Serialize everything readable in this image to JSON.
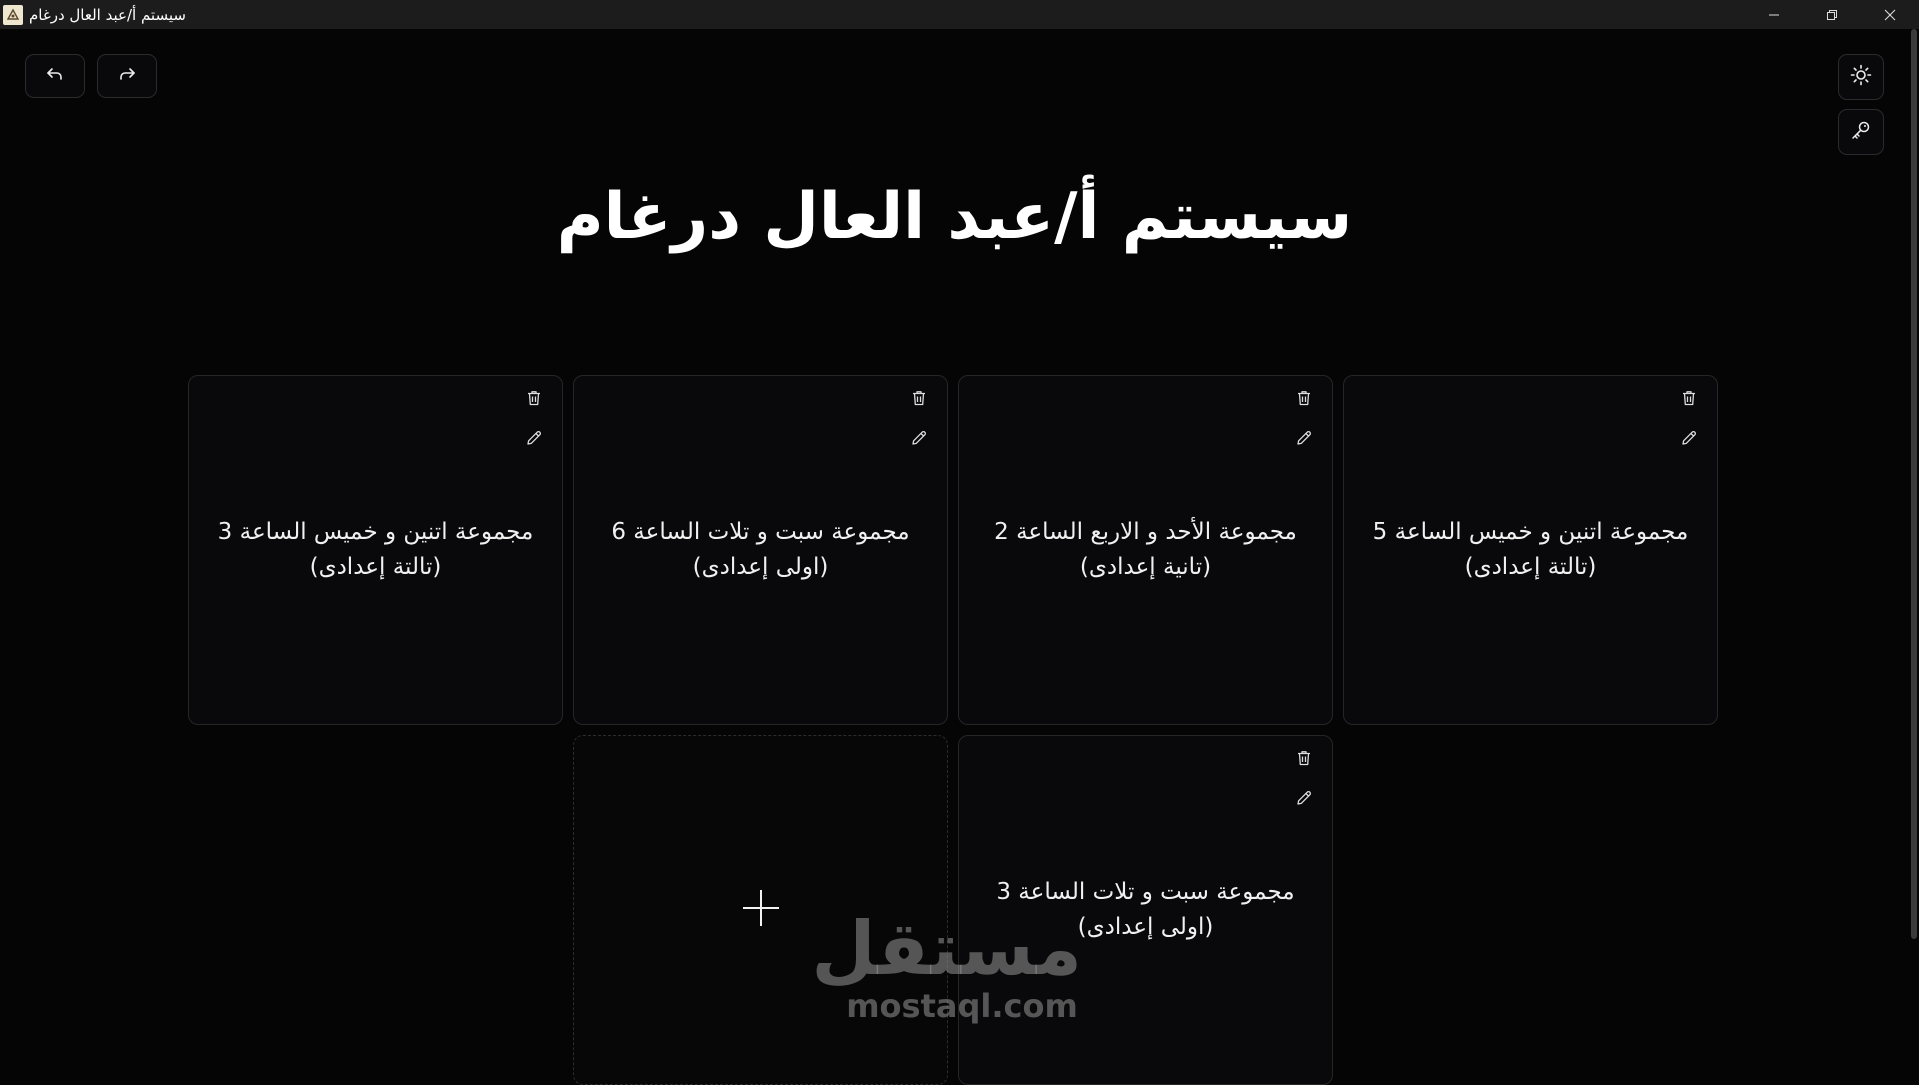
{
  "window": {
    "title": "سيستم أ/عبد العال درغام",
    "controls": [
      "minimize-icon",
      "restore-icon",
      "close-icon"
    ]
  },
  "toolbar": {
    "undo_icon": "undo-arrow-icon",
    "redo_icon": "redo-arrow-icon",
    "theme_icon": "sun-icon",
    "key_icon": "key-icon"
  },
  "page": {
    "title": "سيستم أ/عبد العال درغام"
  },
  "groups": [
    {
      "line1": "مجموعة اتنين و خميس الساعة 5",
      "line2": "(تالتة إعدادى)"
    },
    {
      "line1": "مجموعة الأحد و الاربع الساعة 2",
      "line2": "(تانية إعدادى)"
    },
    {
      "line1": "مجموعة سبت و تلات الساعة 6",
      "line2": "(اولى إعدادى)"
    },
    {
      "line1": "مجموعة اتنين و خميس الساعة 3",
      "line2": "(تالتة إعدادى)"
    },
    {
      "line1": "مجموعة سبت و تلات الساعة 3",
      "line2": "(اولى إعدادى)"
    }
  ],
  "card_actions": {
    "delete_icon": "trash-icon",
    "edit_icon": "pencil-icon",
    "add_icon": "plus-icon"
  },
  "watermark": {
    "arabic": "مستقل",
    "latin": "mostaql.com"
  }
}
